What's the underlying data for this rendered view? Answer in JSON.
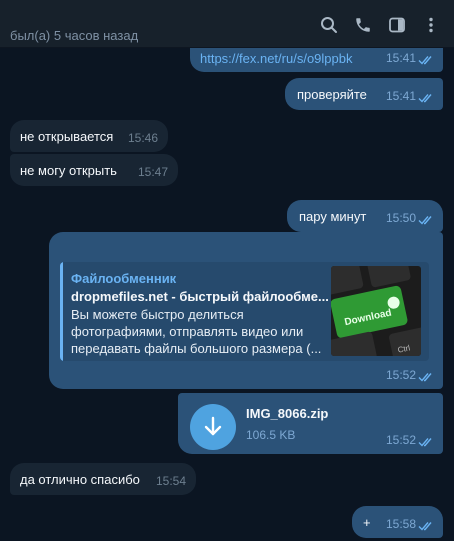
{
  "header": {
    "status": "был(а) 5 часов назад",
    "icons": [
      "search-icon",
      "phone-icon",
      "sidebar-toggle-icon",
      "more-vert-icon"
    ]
  },
  "colors": {
    "outgoing_bubble": "#2b5278",
    "incoming_bubble": "#182533",
    "background": "#0b1522",
    "accent": "#6ab3f3"
  },
  "messages": [
    {
      "dir": "out",
      "text": "https://fex.net/ru/s/o9lppbk",
      "time": "15:41",
      "read": true
    },
    {
      "dir": "out",
      "text": "проверяйте",
      "time": "15:41",
      "read": true
    },
    {
      "dir": "in",
      "text": "не открывается",
      "time": "15:46"
    },
    {
      "dir": "in",
      "text": "не могу открыть",
      "time": "15:47"
    },
    {
      "dir": "out",
      "text": "пару минут",
      "time": "15:50",
      "read": true
    },
    {
      "dir": "out",
      "text": "",
      "time": "15:52",
      "read": true,
      "link_preview": {
        "site": "Файлообменник",
        "title": "dropmefiles.net - быстрый файлообме...",
        "description": "Вы можете быстро делиться фотографиями, отправлять видео или передавать файлы большого размера (...",
        "thumb_key_text": "Download",
        "thumb_ctrl_text": "Ctrl"
      }
    },
    {
      "dir": "out",
      "time": "15:52",
      "read": true,
      "file": {
        "name": "IMG_8066.zip",
        "size": "106.5 KB",
        "icon": "download-icon"
      }
    },
    {
      "dir": "in",
      "text": "да отлично спасибо",
      "time": "15:54"
    },
    {
      "dir": "out",
      "text": "+",
      "time": "15:58",
      "read": true
    }
  ]
}
